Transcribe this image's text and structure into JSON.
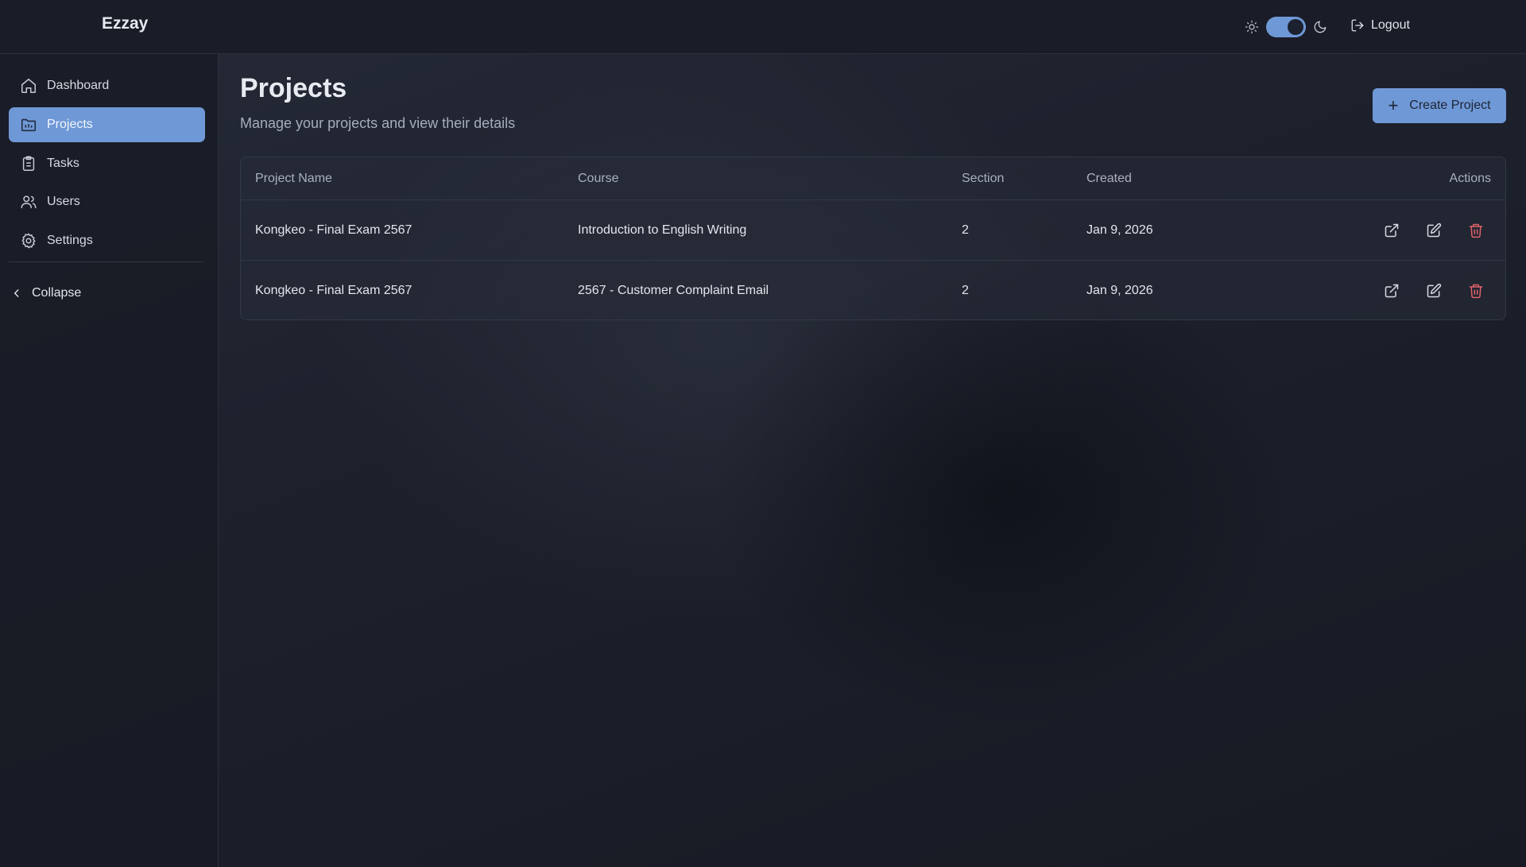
{
  "app": {
    "brand": "Ezzay"
  },
  "header": {
    "logout_label": "Logout",
    "theme": "dark"
  },
  "sidebar": {
    "items": [
      {
        "label": "Dashboard",
        "icon": "home-icon",
        "active": false
      },
      {
        "label": "Projects",
        "icon": "folder-icon",
        "active": true
      },
      {
        "label": "Tasks",
        "icon": "clipboard-icon",
        "active": false
      },
      {
        "label": "Users",
        "icon": "users-icon",
        "active": false
      },
      {
        "label": "Settings",
        "icon": "gear-icon",
        "active": false
      }
    ],
    "collapse_label": "Collapse"
  },
  "main": {
    "title": "Projects",
    "subtitle": "Manage your projects and view their details",
    "create_label": "Create Project"
  },
  "table": {
    "columns": [
      "Project Name",
      "Course",
      "Section",
      "Created",
      "Actions"
    ],
    "rows": [
      {
        "name": "Kongkeo - Final Exam 2567",
        "course": "Introduction to English Writing",
        "section": "2",
        "created": "Jan 9, 2026"
      },
      {
        "name": "Kongkeo - Final Exam 2567",
        "course": "2567 - Customer Complaint Email",
        "section": "2",
        "created": "Jan 9, 2026"
      }
    ]
  },
  "colors": {
    "accent": "#6f98d6",
    "danger": "#e0626a",
    "background": "#1d212c"
  }
}
